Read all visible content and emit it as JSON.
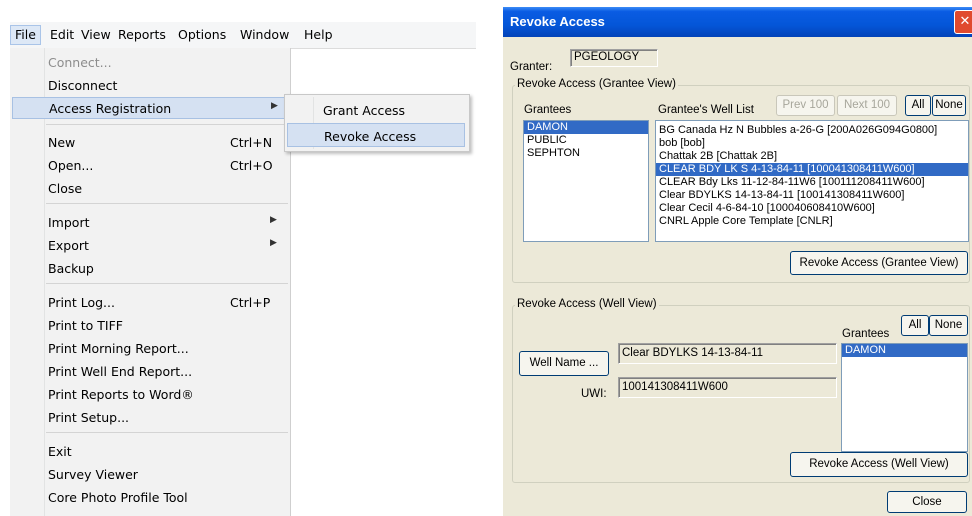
{
  "menubar": {
    "items": [
      "File",
      "Edit",
      "View",
      "Reports",
      "Options",
      "Window",
      "Help"
    ]
  },
  "file_menu": {
    "connect": "Connect...",
    "disconnect": "Disconnect",
    "access_registration": "Access Registration",
    "new": "New",
    "new_sc": "Ctrl+N",
    "open": "Open...",
    "open_sc": "Ctrl+O",
    "close": "Close",
    "import": "Import",
    "export": "Export",
    "backup": "Backup",
    "print_log": "Print Log...",
    "print_log_sc": "Ctrl+P",
    "print_tiff": "Print to TIFF",
    "print_morning": "Print Morning Report...",
    "print_well_end": "Print Well End Report...",
    "print_word": "Print Reports to Word®",
    "print_setup": "Print Setup...",
    "exit": "Exit",
    "survey_viewer": "Survey Viewer",
    "core_photo": "Core Photo Profile Tool"
  },
  "submenu": {
    "grant": "Grant Access",
    "revoke": "Revoke Access"
  },
  "dialog": {
    "title": "Revoke Access",
    "granter_label": "Granter:",
    "granter_value": "PGEOLOGY",
    "grantee_view_group": "Revoke Access (Grantee View)",
    "grantees_label": "Grantees",
    "grantees": [
      "DAMON",
      "PUBLIC",
      "SEPHTON"
    ],
    "selected_grantee": "DAMON",
    "well_list_label": "Grantee's Well List",
    "prev_button": "Prev 100",
    "next_button": "Next 100",
    "all_button": "All",
    "none_button": "None",
    "wells": [
      "BG Canada Hz N Bubbles a-26-G  [200A026G094G0800]",
      "bob  [bob]",
      "Chattak 2B  [Chattak 2B]",
      "CLEAR BDY LK S 4-13-84-11  [100041308411W600]",
      "CLEAR Bdy Lks 11-12-84-11W6  [100111208411W600]",
      "Clear BDYLKS 14-13-84-11  [100141308411W600]",
      "Clear Cecil 4-6-84-10  [100040608410W600]",
      "CNRL Apple Core Template  [CNLR]"
    ],
    "selected_well": "CLEAR BDY LK S 4-13-84-11  [100041308411W600]",
    "revoke_grantee_button": "Revoke Access (Grantee View)",
    "well_view_group": "Revoke Access (Well View)",
    "well_name_button": "Well Name ...",
    "well_name_value": "Clear BDYLKS 14-13-84-11",
    "uwi_label": "UWI:",
    "uwi_value": "100141308411W600",
    "grantees2_label": "Grantees",
    "all_button2": "All",
    "none_button2": "None",
    "grantees2": [
      "DAMON"
    ],
    "revoke_well_button": "Revoke Access (Well View)",
    "close_button": "Close"
  },
  "colors": {
    "selection": "#316ac5",
    "menu_highlight": "#d5e1f2",
    "titlebar": "#0456d8",
    "dialog_bg": "#ece9d8"
  }
}
